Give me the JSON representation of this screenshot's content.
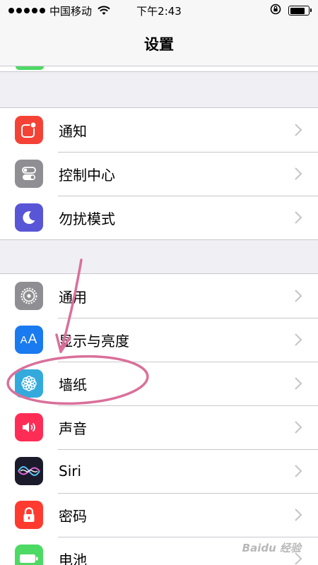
{
  "status_bar": {
    "carrier": "中国移动",
    "time": "下午2:43"
  },
  "nav": {
    "title": "设置"
  },
  "groups": [
    {
      "items": [
        {
          "label": "通知",
          "icon": "notifications-icon",
          "color": "#f44336"
        },
        {
          "label": "控制中心",
          "icon": "control-center-icon",
          "color": "#8e8e93"
        },
        {
          "label": "勿扰模式",
          "icon": "moon-icon",
          "color": "#5856d6"
        }
      ]
    },
    {
      "items": [
        {
          "label": "通用",
          "icon": "gear-icon",
          "color": "#8e8e93"
        },
        {
          "label": "显示与亮度",
          "icon": "display-aa-icon",
          "color": "#1a7af0"
        },
        {
          "label": "墙纸",
          "icon": "wallpaper-flower-icon",
          "color": "#34aadc"
        },
        {
          "label": "声音",
          "icon": "speaker-icon",
          "color": "#ff2d55"
        },
        {
          "label": "Siri",
          "icon": "siri-icon",
          "color": "#1b1b2b"
        },
        {
          "label": "密码",
          "icon": "lock-icon",
          "color": "#ff3b30"
        },
        {
          "label": "电池",
          "icon": "battery-icon",
          "color": "#4cd964"
        }
      ]
    }
  ],
  "annotation": {
    "color": "#d9709a"
  },
  "watermark": "Baidu 经验"
}
